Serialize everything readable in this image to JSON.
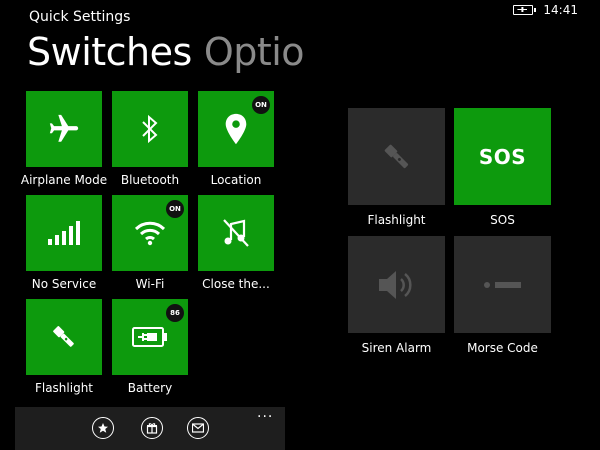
{
  "header": {
    "app_title": "Quick Settings",
    "pivot_active": "Switches",
    "pivot_next": "Optio"
  },
  "status": {
    "time": "14:41",
    "battery_icon": "battery-charging-icon"
  },
  "switches": [
    {
      "label": "Airplane Mode",
      "icon": "airplane-icon"
    },
    {
      "label": "Bluetooth",
      "icon": "bluetooth-icon"
    },
    {
      "label": "Location",
      "icon": "location-pin-icon",
      "badge": "ON"
    },
    {
      "label": "No Service",
      "icon": "signal-bars-icon"
    },
    {
      "label": "Wi-Fi",
      "icon": "wifi-icon",
      "badge": "ON"
    },
    {
      "label": "Close the...",
      "icon": "music-off-icon"
    },
    {
      "label": "Flashlight",
      "icon": "flashlight-icon"
    },
    {
      "label": "Battery",
      "icon": "battery-icon",
      "badge": "86"
    }
  ],
  "options": [
    {
      "label": "Flashlight",
      "icon": "flashlight-icon"
    },
    {
      "label": "SOS",
      "tile_text": "SOS"
    },
    {
      "label": "Siren Alarm",
      "icon": "speaker-icon"
    },
    {
      "label": "Morse Code",
      "icon": "morse-icon"
    }
  ],
  "appbar": {
    "buttons": [
      "star-icon",
      "gift-icon",
      "mail-icon"
    ],
    "more": "..."
  },
  "colors": {
    "tile_green": "#0d9a0d",
    "tile_dark": "#2b2b2b",
    "background": "#000000"
  }
}
